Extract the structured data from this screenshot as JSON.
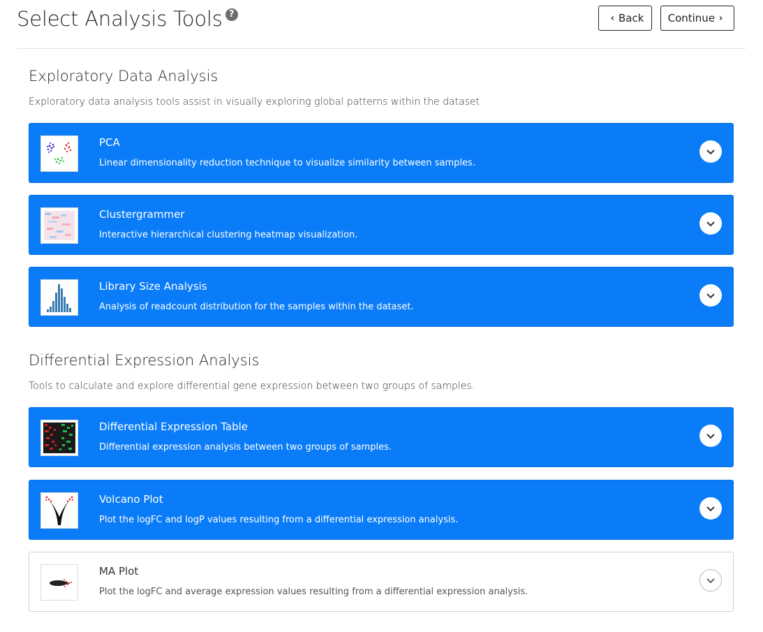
{
  "header": {
    "title": "Select Analysis Tools",
    "help_icon_glyph": "?",
    "back_label": "Back",
    "continue_label": "Continue"
  },
  "sections": [
    {
      "title": "Exploratory Data Analysis",
      "description": "Exploratory data analysis tools assist in visually exploring global patterns within the dataset",
      "tools": [
        {
          "name": "PCA",
          "description": "Linear dimensionality reduction technique to visualize similarity between samples.",
          "selected": true,
          "icon": "pca-scatter-thumbnail"
        },
        {
          "name": "Clustergrammer",
          "description": "Interactive hierarchical clustering heatmap visualization.",
          "selected": true,
          "icon": "heatmap-thumbnail"
        },
        {
          "name": "Library Size Analysis",
          "description": "Analysis of readcount distribution for the samples within the dataset.",
          "selected": true,
          "icon": "histogram-thumbnail"
        }
      ]
    },
    {
      "title": "Differential Expression Analysis",
      "description": "Tools to calculate and explore differential gene expression between two groups of samples.",
      "tools": [
        {
          "name": "Differential Expression Table",
          "description": "Differential expression analysis between two groups of samples.",
          "selected": true,
          "icon": "expression-table-thumbnail"
        },
        {
          "name": "Volcano Plot",
          "description": "Plot the logFC and logP values resulting from a differential expression analysis.",
          "selected": true,
          "icon": "volcano-plot-thumbnail"
        },
        {
          "name": "MA Plot",
          "description": "Plot the logFC and average expression values resulting from a differential expression analysis.",
          "selected": false,
          "icon": "ma-plot-thumbnail"
        }
      ]
    }
  ],
  "colors": {
    "selected_card": "#0a7cf7",
    "unselected_card": "#ffffff"
  }
}
